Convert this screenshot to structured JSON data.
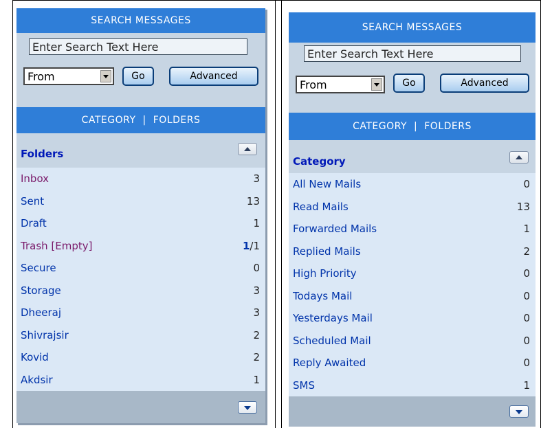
{
  "left_panel": {
    "search": {
      "title": "SEARCH MESSAGES",
      "placeholder": "Enter Search Text Here",
      "field_select": "From",
      "go_label": "Go",
      "advanced_label": "Advanced"
    },
    "tabs": {
      "category": "CATEGORY",
      "separator": "|",
      "folders": "FOLDERS"
    },
    "section_title": "Folders",
    "items": [
      {
        "label": "Inbox",
        "count": "3"
      },
      {
        "label": "Sent",
        "count": "13"
      },
      {
        "label": "Draft",
        "count": "1"
      },
      {
        "label": "Trash [Empty]",
        "count_unread": "1",
        "count_total": "/1"
      },
      {
        "label": "Secure",
        "count": "0"
      },
      {
        "label": "Storage",
        "count": "3"
      },
      {
        "label": "Dheeraj",
        "count": "3"
      },
      {
        "label": "Shivrajsir",
        "count": "2"
      },
      {
        "label": "Kovid",
        "count": "2"
      },
      {
        "label": "Akdsir",
        "count": "1"
      }
    ]
  },
  "right_panel": {
    "search": {
      "title": "SEARCH MESSAGES",
      "placeholder": "Enter Search Text Here",
      "field_select": "From",
      "go_label": "Go",
      "advanced_label": "Advanced"
    },
    "tabs": {
      "category": "CATEGORY",
      "separator": "|",
      "folders": "FOLDERS"
    },
    "section_title": "Category",
    "items": [
      {
        "label": "All New Mails",
        "count": "0"
      },
      {
        "label": "Read Mails",
        "count": "13"
      },
      {
        "label": "Forwarded Mails",
        "count": "1"
      },
      {
        "label": "Replied Mails",
        "count": "2"
      },
      {
        "label": "High Priority",
        "count": "0"
      },
      {
        "label": "Todays Mail",
        "count": "0"
      },
      {
        "label": "Yesterdays Mail",
        "count": "0"
      },
      {
        "label": "Scheduled Mail",
        "count": "0"
      },
      {
        "label": "Reply Awaited",
        "count": "0"
      },
      {
        "label": "SMS",
        "count": "1"
      }
    ]
  },
  "colors": {
    "bar_blue": "#2f7ed8",
    "panel_bg": "#c7d5e3",
    "list_bg": "#dbe8f6",
    "link_blue": "#0033aa",
    "visited_purple": "#7a1a6a"
  }
}
